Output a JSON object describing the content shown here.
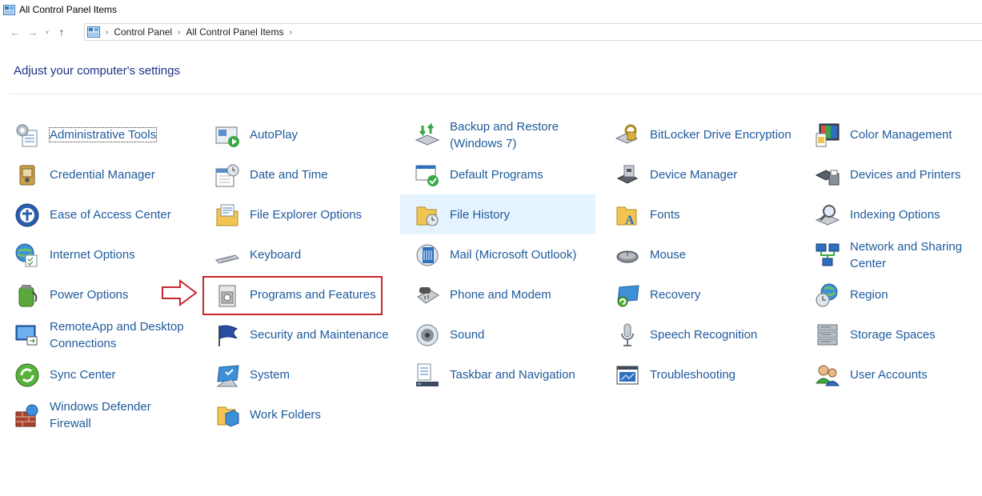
{
  "window": {
    "title": "All Control Panel Items"
  },
  "nav": {
    "back": "←",
    "forward": "→",
    "recent": "▾",
    "up": "↑",
    "breadcrumbs": [
      "Control Panel",
      "All Control Panel Items"
    ],
    "separator": "›"
  },
  "heading": "Adjust your computer's settings",
  "items": [
    {
      "label": "Administrative Tools",
      "icon": "admin-tools-icon"
    },
    {
      "label": "Credential Manager",
      "icon": "credential-manager-icon"
    },
    {
      "label": "Ease of Access Center",
      "icon": "ease-of-access-icon"
    },
    {
      "label": "Internet Options",
      "icon": "internet-options-icon"
    },
    {
      "label": "Power Options",
      "icon": "power-options-icon"
    },
    {
      "label": "RemoteApp and Desktop Connections",
      "icon": "remoteapp-icon"
    },
    {
      "label": "Sync Center",
      "icon": "sync-center-icon"
    },
    {
      "label": "Windows Defender Firewall",
      "icon": "firewall-icon"
    },
    {
      "label": "AutoPlay",
      "icon": "autoplay-icon"
    },
    {
      "label": "Date and Time",
      "icon": "date-time-icon"
    },
    {
      "label": "File Explorer Options",
      "icon": "file-explorer-options-icon"
    },
    {
      "label": "Keyboard",
      "icon": "keyboard-icon"
    },
    {
      "label": "Programs and Features",
      "icon": "programs-features-icon"
    },
    {
      "label": "Security and Maintenance",
      "icon": "security-maintenance-icon"
    },
    {
      "label": "System",
      "icon": "system-icon"
    },
    {
      "label": "Work Folders",
      "icon": "work-folders-icon"
    },
    {
      "label": "Backup and Restore (Windows 7)",
      "icon": "backup-restore-icon"
    },
    {
      "label": "Default Programs",
      "icon": "default-programs-icon"
    },
    {
      "label": "File History",
      "icon": "file-history-icon"
    },
    {
      "label": "Mail (Microsoft Outlook)",
      "icon": "mail-icon"
    },
    {
      "label": "Phone and Modem",
      "icon": "phone-modem-icon"
    },
    {
      "label": "Sound",
      "icon": "sound-icon"
    },
    {
      "label": "Taskbar and Navigation",
      "icon": "taskbar-icon"
    },
    {
      "label": "BitLocker Drive Encryption",
      "icon": "bitlocker-icon"
    },
    {
      "label": "Device Manager",
      "icon": "device-manager-icon"
    },
    {
      "label": "Fonts",
      "icon": "fonts-icon"
    },
    {
      "label": "Mouse",
      "icon": "mouse-icon"
    },
    {
      "label": "Recovery",
      "icon": "recovery-icon"
    },
    {
      "label": "Speech Recognition",
      "icon": "speech-recognition-icon"
    },
    {
      "label": "Troubleshooting",
      "icon": "troubleshooting-icon"
    },
    {
      "label": "Color Management",
      "icon": "color-management-icon"
    },
    {
      "label": "Devices and Printers",
      "icon": "devices-printers-icon"
    },
    {
      "label": "Indexing Options",
      "icon": "indexing-options-icon"
    },
    {
      "label": "Network and Sharing Center",
      "icon": "network-sharing-icon"
    },
    {
      "label": "Region",
      "icon": "region-icon"
    },
    {
      "label": "Storage Spaces",
      "icon": "storage-spaces-icon"
    },
    {
      "label": "User Accounts",
      "icon": "user-accounts-icon"
    }
  ],
  "colors": {
    "link": "#1e5a9c",
    "heading": "#1e3287",
    "highlight": "#e5f3ff",
    "annotation": "#c8262d"
  }
}
